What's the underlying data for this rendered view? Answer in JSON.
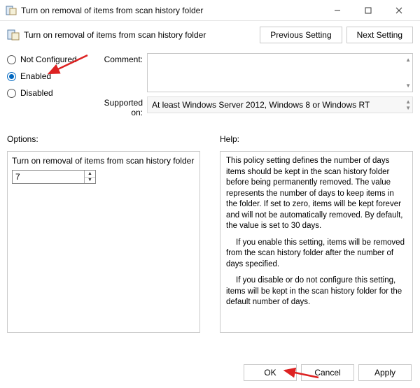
{
  "window": {
    "title": "Turn on removal of items from scan history folder"
  },
  "header": {
    "label": "Turn on removal of items from scan history folder",
    "prev": "Previous Setting",
    "next": "Next Setting"
  },
  "radios": {
    "not_configured": "Not Configured",
    "enabled": "Enabled",
    "disabled": "Disabled",
    "selected": "enabled"
  },
  "fields": {
    "comment_label": "Comment:",
    "comment_value": "",
    "supported_label": "Supported on:",
    "supported_value": "At least Windows Server 2012, Windows 8 or Windows RT"
  },
  "options": {
    "section": "Options:",
    "label": "Turn on removal of items from scan history folder",
    "value": "7"
  },
  "help": {
    "section": "Help:",
    "p1": "This policy setting defines the number of days items should be kept in the scan history folder before being permanently removed. The value represents the number of days to keep items in the folder. If set to zero, items will be kept forever and will not be automatically removed. By default, the value is set to 30 days.",
    "p2": "If you enable this setting, items will be removed from the scan history folder after the number of days specified.",
    "p3": "If you disable or do not configure this setting, items will be kept in the scan history folder for the default number of days."
  },
  "buttons": {
    "ok": "OK",
    "cancel": "Cancel",
    "apply": "Apply"
  }
}
